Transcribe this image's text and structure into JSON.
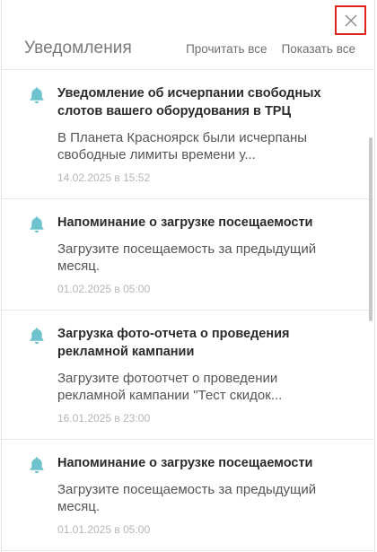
{
  "panel": {
    "title": "Уведомления",
    "read_all_label": "Прочитать все",
    "show_all_label": "Показать все",
    "close_icon": "close-icon",
    "colors": {
      "accent_bell": "#6ec3cf",
      "close_highlight": "#e0231e"
    }
  },
  "notifications": [
    {
      "title": "Уведомление об исчерпании свободных слотов вашего оборудования в ТРЦ",
      "body": "В Планета Красноярск были исчерпаны свободные лимиты времени у...",
      "date": "14.02.2025 в 15:52",
      "icon": "bell-icon"
    },
    {
      "title": "Напоминание о загрузке посещаемости",
      "body": "Загрузите посещаемость за предыдущий месяц.",
      "date": "01.02.2025 в 05:00",
      "icon": "bell-icon"
    },
    {
      "title": "Загрузка фото-отчета о проведения рекламной кампании",
      "body": "Загрузите фотоотчет о проведении рекламной кампании \"Тест скидок...",
      "date": "16.01.2025 в 23:00",
      "icon": "bell-icon"
    },
    {
      "title": "Напоминание о загрузке посещаемости",
      "body": "Загрузите посещаемость за предыдущий месяц.",
      "date": "01.01.2025 в 05:00",
      "icon": "bell-icon"
    }
  ]
}
